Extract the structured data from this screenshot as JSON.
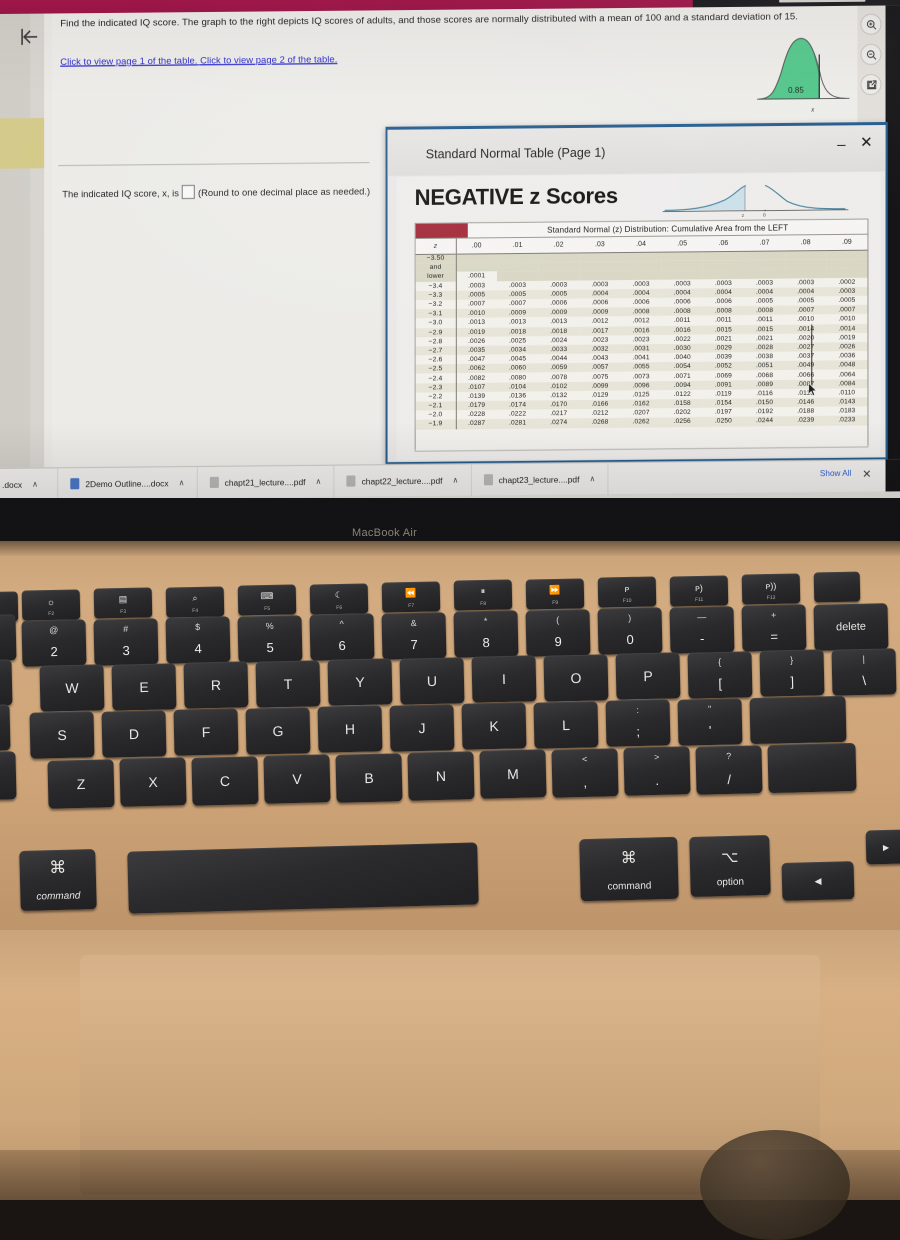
{
  "question": {
    "prompt": "Find the indicated IQ score. The graph to the right depicts IQ scores of adults, and those scores are normally distributed with a mean of 100 and a standard deviation of 15.",
    "link1": "Click to view page 1 of the table.",
    "link2": "Click to view page 2 of the table.",
    "answer_prefix": "The indicated IQ score, x, is",
    "answer_value": "",
    "answer_suffix": "(Round to one decimal place as needed.)",
    "curve_area_label": "0.85",
    "curve_axis_label": "x"
  },
  "toolbar": {
    "back_icon": "back-to-start-icon",
    "zoom_in_icon": "zoom-in-icon",
    "zoom_out_icon": "zoom-out-icon",
    "expand_icon": "open-in-new-icon"
  },
  "modal": {
    "title": "Standard Normal Table (Page 1)",
    "minimize_label": "–",
    "close_label": "✕",
    "heading": "NEGATIVE z Scores",
    "curve_labels": [
      "z",
      "0"
    ],
    "table_caption": "Standard Normal (z) Distribution: Cumulative Area from the LEFT"
  },
  "chart_data": {
    "type": "table",
    "title": "Standard Normal (z) Distribution: Cumulative Area from the LEFT",
    "subtitle": "NEGATIVE z Scores",
    "columns": [
      "z",
      ".00",
      ".01",
      ".02",
      ".03",
      ".04",
      ".05",
      ".06",
      ".07",
      ".08",
      ".09"
    ],
    "rows": [
      {
        "z": "−3.50\nand\nlower",
        "values": [
          ".0001",
          "",
          "",
          "",
          "",
          "",
          "",
          "",
          "",
          ""
        ]
      },
      {
        "z": "−3.4",
        "values": [
          ".0003",
          ".0003",
          ".0003",
          ".0003",
          ".0003",
          ".0003",
          ".0003",
          ".0003",
          ".0003",
          ".0002"
        ]
      },
      {
        "z": "−3.3",
        "values": [
          ".0005",
          ".0005",
          ".0005",
          ".0004",
          ".0004",
          ".0004",
          ".0004",
          ".0004",
          ".0004",
          ".0003"
        ]
      },
      {
        "z": "−3.2",
        "values": [
          ".0007",
          ".0007",
          ".0006",
          ".0006",
          ".0006",
          ".0006",
          ".0006",
          ".0005",
          ".0005",
          ".0005"
        ]
      },
      {
        "z": "−3.1",
        "values": [
          ".0010",
          ".0009",
          ".0009",
          ".0009",
          ".0008",
          ".0008",
          ".0008",
          ".0008",
          ".0007",
          ".0007"
        ]
      },
      {
        "z": "−3.0",
        "values": [
          ".0013",
          ".0013",
          ".0013",
          ".0012",
          ".0012",
          ".0011",
          ".0011",
          ".0011",
          ".0010",
          ".0010"
        ]
      },
      {
        "z": "−2.9",
        "values": [
          ".0019",
          ".0018",
          ".0018",
          ".0017",
          ".0016",
          ".0016",
          ".0015",
          ".0015",
          ".0014",
          ".0014"
        ]
      },
      {
        "z": "−2.8",
        "values": [
          ".0026",
          ".0025",
          ".0024",
          ".0023",
          ".0023",
          ".0022",
          ".0021",
          ".0021",
          ".0020",
          ".0019"
        ]
      },
      {
        "z": "−2.7",
        "values": [
          ".0035",
          ".0034",
          ".0033",
          ".0032",
          ".0031",
          ".0030",
          ".0029",
          ".0028",
          ".0027",
          ".0026"
        ]
      },
      {
        "z": "−2.6",
        "values": [
          ".0047",
          ".0045",
          ".0044",
          ".0043",
          ".0041",
          ".0040",
          ".0039",
          ".0038",
          ".0037",
          ".0036"
        ]
      },
      {
        "z": "−2.5",
        "values": [
          ".0062",
          ".0060",
          ".0059",
          ".0057",
          ".0055",
          ".0054",
          ".0052",
          ".0051",
          ".0049",
          ".0048"
        ]
      },
      {
        "z": "−2.4",
        "values": [
          ".0082",
          ".0080",
          ".0078",
          ".0075",
          ".0073",
          ".0071",
          ".0069",
          ".0068",
          ".0066",
          ".0064"
        ]
      },
      {
        "z": "−2.3",
        "values": [
          ".0107",
          ".0104",
          ".0102",
          ".0099",
          ".0096",
          ".0094",
          ".0091",
          ".0089",
          ".0087",
          ".0084"
        ]
      },
      {
        "z": "−2.2",
        "values": [
          ".0139",
          ".0136",
          ".0132",
          ".0129",
          ".0125",
          ".0122",
          ".0119",
          ".0116",
          ".0113",
          ".0110"
        ]
      },
      {
        "z": "−2.1",
        "values": [
          ".0179",
          ".0174",
          ".0170",
          ".0166",
          ".0162",
          ".0158",
          ".0154",
          ".0150",
          ".0146",
          ".0143"
        ]
      },
      {
        "z": "−2.0",
        "values": [
          ".0228",
          ".0222",
          ".0217",
          ".0212",
          ".0207",
          ".0202",
          ".0197",
          ".0192",
          ".0188",
          ".0183"
        ]
      },
      {
        "z": "−1.9",
        "values": [
          ".0287",
          ".0281",
          ".0274",
          ".0268",
          ".0262",
          ".0256",
          ".0250",
          ".0244",
          ".0239",
          ".0233"
        ]
      }
    ]
  },
  "downloads": {
    "items": [
      {
        "label": ".docx",
        "icon": "word-doc-icon"
      },
      {
        "label": "2Demo Outline....docx",
        "icon": "word-doc-icon"
      },
      {
        "label": "chapt21_lecture....pdf",
        "icon": "pdf-icon"
      },
      {
        "label": "chapt22_lecture....pdf",
        "icon": "pdf-icon"
      },
      {
        "label": "chapt23_lecture....pdf",
        "icon": "pdf-icon"
      }
    ],
    "show_all": "Show All",
    "close": "✕",
    "caret": "∧"
  },
  "laptop": {
    "brand": "MacBook Air",
    "function_keys": [
      {
        "sub": "F2",
        "glyph": "☼"
      },
      {
        "sub": "F3",
        "glyph": "▤"
      },
      {
        "sub": "F4",
        "glyph": "⌕"
      },
      {
        "sub": "F5",
        "glyph": "⌨"
      },
      {
        "sub": "F6",
        "glyph": "☾"
      },
      {
        "sub": "F7",
        "glyph": "⏪"
      },
      {
        "sub": "F8",
        "glyph": "⏸"
      },
      {
        "sub": "F9",
        "glyph": "⏩"
      },
      {
        "sub": "F10",
        "glyph": "ᴘ"
      },
      {
        "sub": "F11",
        "glyph": "ᴘ)"
      },
      {
        "sub": "F12",
        "glyph": "ᴘ))"
      }
    ],
    "number_row": [
      {
        "top": "@",
        "bot": "2"
      },
      {
        "top": "#",
        "bot": "3"
      },
      {
        "top": "$",
        "bot": "4"
      },
      {
        "top": "%",
        "bot": "5"
      },
      {
        "top": "^",
        "bot": "6"
      },
      {
        "top": "&",
        "bot": "7"
      },
      {
        "top": "*",
        "bot": "8"
      },
      {
        "top": "(",
        "bot": "9"
      },
      {
        "top": ")",
        "bot": "0"
      },
      {
        "top": "—",
        "bot": "-"
      },
      {
        "top": "+",
        "bot": "="
      }
    ],
    "delete_key": "delete",
    "row_q": [
      "W",
      "E",
      "R",
      "T",
      "Y",
      "U",
      "I",
      "O",
      "P"
    ],
    "bracket_keys": [
      {
        "top": "{",
        "bot": "["
      },
      {
        "top": "}",
        "bot": "]"
      },
      {
        "top": "|",
        "bot": "\\"
      }
    ],
    "row_a": [
      "S",
      "D",
      "F",
      "G",
      "H",
      "J",
      "K",
      "L"
    ],
    "punct_keys": [
      {
        "top": ":",
        "bot": ";"
      },
      {
        "top": "\"",
        "bot": "'"
      }
    ],
    "row_z": [
      "Z",
      "X",
      "C",
      "V",
      "B",
      "N",
      "M"
    ],
    "row_z_punct": [
      {
        "top": "<",
        "bot": ","
      },
      {
        "top": ">",
        "bot": "."
      },
      {
        "top": "?",
        "bot": "/"
      }
    ],
    "cmd_left_glyph": "⌘",
    "cmd_left_label": "command",
    "cmd_right_glyph": "⌘",
    "cmd_right_label": "command",
    "opt_glyph": "⌥",
    "opt_label": "option",
    "arrow_left": "◀",
    "arrow_right": "▶"
  },
  "colors": {
    "brand_band": "#a7134a",
    "link": "#2b2bd0",
    "curve_fill": "#4fc98a",
    "table_red": "#a32535",
    "modal_border": "#1f5b8f"
  }
}
